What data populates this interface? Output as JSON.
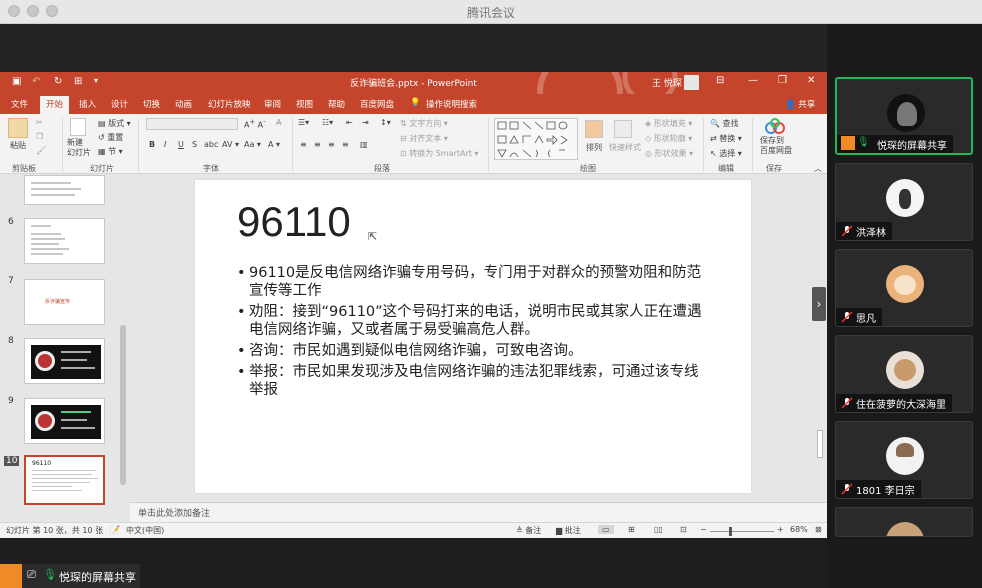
{
  "meeting": {
    "window_title": "腾讯会议",
    "share_label": "悦琛的屏幕共享"
  },
  "ppt": {
    "doc_title": "反诈骗班会.pptx - PowerPoint",
    "user": "王 悦琛",
    "share": "共享",
    "tabs": [
      "文件",
      "开始",
      "插入",
      "设计",
      "切换",
      "动画",
      "幻灯片放映",
      "审阅",
      "视图",
      "帮助",
      "百度网盘",
      "操作说明搜索"
    ],
    "active_tab": "开始",
    "ribbon": {
      "paste": "粘贴",
      "new_slide": "新建\n幻灯片",
      "layout": "版式",
      "reset": "重置",
      "section": "节",
      "text_direction": "文字方向",
      "align_text": "对齐文本",
      "convert_smartart": "转换为 SmartArt",
      "arrange": "排列",
      "quick_styles": "快速样式",
      "shape_fill": "形状填充",
      "shape_outline": "形状轮廓",
      "shape_effects": "形状效果",
      "find": "查找",
      "replace": "替换",
      "select": "选择",
      "save_to": "保存到\n百度网盘",
      "groups": [
        "剪贴板",
        "幻灯片",
        "字体",
        "段落",
        "绘图",
        "编辑",
        "保存"
      ]
    },
    "thumbs": [
      {
        "num": "6"
      },
      {
        "num": "7"
      },
      {
        "num": "8"
      },
      {
        "num": "9"
      },
      {
        "num": "10",
        "title": "96110"
      }
    ],
    "thumb7_text": "反诈骗宣传",
    "slide": {
      "title": "96110",
      "bullets": [
        "96110是反电信网络诈骗专用号码，专门用于对群众的预警劝阻和防范宣传等工作",
        "劝阻：接到“96110”这个号码打来的电话，说明市民或其家人正在遭遇电信网络诈骗，又或者属于易受骗高危人群。",
        "咨询：市民如遇到疑似电信网络诈骗，可致电咨询。",
        "举报：市民如果发现涉及电信网络诈骗的违法犯罪线索，可通过该专线举报"
      ]
    },
    "notes_placeholder": "单击此处添加备注",
    "status": {
      "slide_info": "幻灯片 第 10 张，共 10 张",
      "language": "中文(中国)",
      "notes": "备注",
      "comments": "批注",
      "zoom": "68%"
    }
  },
  "participants": [
    {
      "name": "悦琛的屏幕共享",
      "speaking": true
    },
    {
      "name": "洪泽林"
    },
    {
      "name": "思凡"
    },
    {
      "name": "住在菠萝的大深海里"
    },
    {
      "name": "1801 李日宗"
    }
  ],
  "colors": {
    "ppt_accent": "#c4452b",
    "speaking_border": "#1fb955"
  }
}
